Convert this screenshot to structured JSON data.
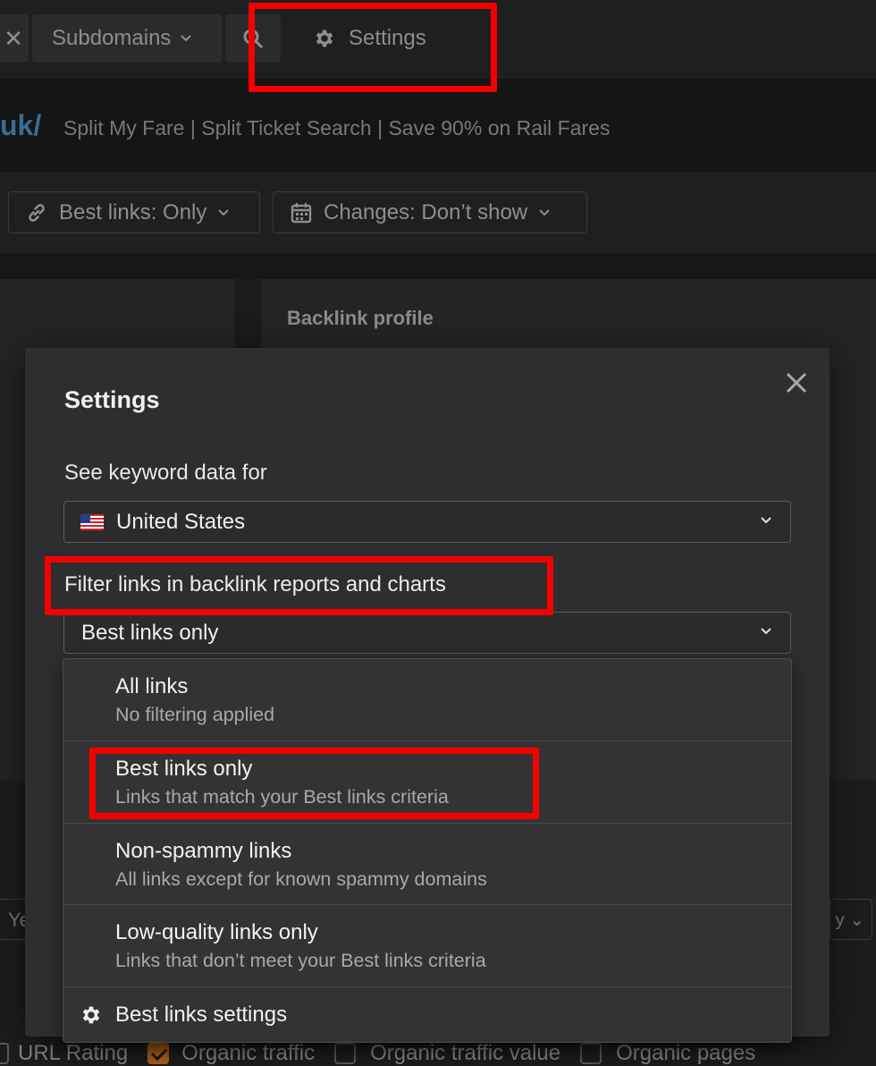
{
  "topbar": {
    "close_glyph": "✕",
    "subdomains_label": "Subdomains",
    "search_icon": "search-icon",
    "settings_label": "Settings"
  },
  "site": {
    "url_fragment": "uk/",
    "title": "Split My Fare | Split Ticket Search | Save 90% on Rail Fares"
  },
  "filters": {
    "best_links": "Best links: Only",
    "changes": "Changes: Don’t show"
  },
  "panel": {
    "backlink_profile": "Backlink profile"
  },
  "background_fragments": {
    "ye": "Ye",
    "right_chevron": "y ⌄"
  },
  "checkbox_row": [
    {
      "label": "URL Rating",
      "checked": false
    },
    {
      "label": "Organic traffic",
      "checked": true
    },
    {
      "label": "Organic traffic value",
      "checked": false
    },
    {
      "label": "Organic pages",
      "checked": false
    }
  ],
  "modal": {
    "title": "Settings",
    "keyword_label": "See keyword data for",
    "country": "United States",
    "filter_label": "Filter links in backlink reports and charts",
    "filter_value": "Best links only",
    "options": [
      {
        "title": "All links",
        "desc": "No filtering applied"
      },
      {
        "title": "Best links only",
        "desc": "Links that match your Best links criteria"
      },
      {
        "title": "Non-spammy links",
        "desc": "All links except for known spammy domains"
      },
      {
        "title": "Low-quality links only",
        "desc": "Links that don’t meet your Best links criteria"
      }
    ],
    "settings_link": "Best links settings"
  },
  "colors": {
    "highlight": "#f40000",
    "accent_url": "#3a6c91",
    "checkbox_checked": "#b35f17"
  }
}
